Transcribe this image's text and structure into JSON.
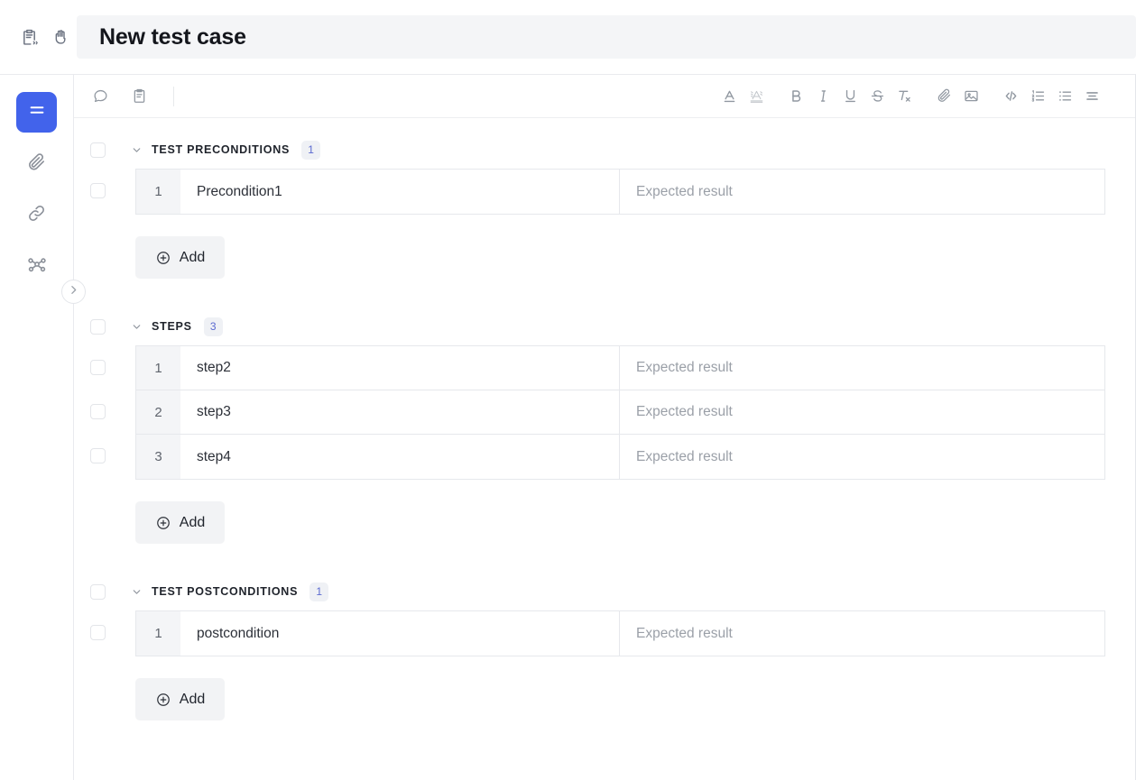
{
  "topbar": {
    "icons": [
      {
        "name": "clipboard-code-icon",
        "label": "clipboard-code"
      },
      {
        "name": "hand-icon",
        "label": "hand"
      }
    ],
    "title": "New test case"
  },
  "rail": {
    "items": [
      {
        "name": "sidebar-item-description",
        "icon": "lines-icon",
        "active": true
      },
      {
        "name": "sidebar-item-attachments",
        "icon": "paperclip-icon",
        "active": false
      },
      {
        "name": "sidebar-item-links",
        "icon": "link-icon",
        "active": false
      },
      {
        "name": "sidebar-item-relations",
        "icon": "node-graph-icon",
        "active": false
      }
    ],
    "toggle": {
      "name": "rail-expand-toggle",
      "icon": "chevron-right-icon"
    }
  },
  "toolbar": {
    "left": [
      {
        "name": "comment-icon"
      },
      {
        "name": "clipboard-icon"
      }
    ],
    "right": [
      {
        "name": "text-color-icon"
      },
      {
        "name": "highlight-color-icon"
      },
      {
        "name": "bold-icon"
      },
      {
        "name": "italic-icon"
      },
      {
        "name": "underline-icon"
      },
      {
        "name": "strikethrough-icon"
      },
      {
        "name": "clear-format-icon"
      },
      {
        "name": "attach-link-icon"
      },
      {
        "name": "image-icon"
      },
      {
        "name": "code-icon"
      },
      {
        "name": "ordered-list-icon"
      },
      {
        "name": "bullet-list-icon"
      },
      {
        "name": "align-icon"
      }
    ]
  },
  "expected_placeholder": "Expected result",
  "add_label": "Add",
  "sections": [
    {
      "id": "preconditions",
      "title": "TEST PRECONDITIONS",
      "count": "1",
      "rows": [
        {
          "num": "1",
          "text": "Precondition1",
          "expected": ""
        }
      ]
    },
    {
      "id": "steps",
      "title": "STEPS",
      "count": "3",
      "rows": [
        {
          "num": "1",
          "text": "step2",
          "expected": ""
        },
        {
          "num": "2",
          "text": "step3",
          "expected": ""
        },
        {
          "num": "3",
          "text": "step4",
          "expected": ""
        }
      ]
    },
    {
      "id": "postconditions",
      "title": "TEST POSTCONDITIONS",
      "count": "1",
      "rows": [
        {
          "num": "1",
          "text": "postcondition",
          "expected": ""
        }
      ]
    }
  ],
  "colors": {
    "accent": "#4263eb",
    "badge_text": "#5b6ad0",
    "badge_bg": "#eff1f5",
    "placeholder": "#9ba0a8",
    "border": "#e6e8ec",
    "num_bg": "#f4f5f7"
  }
}
